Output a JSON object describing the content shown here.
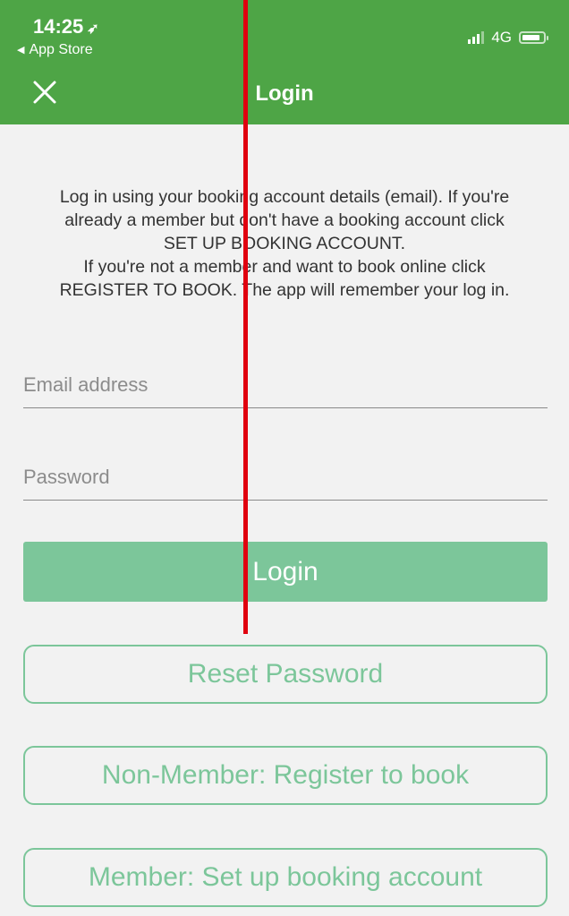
{
  "status_bar": {
    "time": "14:25",
    "back_app": "App Store",
    "network": "4G"
  },
  "header": {
    "title": "Login"
  },
  "intro_text": "Log in using your booking account details (email). If you're\nalready a member but don't have a booking account click\nSET UP BOOKING ACCOUNT.\nIf you're not a member and want to book online click\nREGISTER TO BOOK.  The app will remember your log in.",
  "form": {
    "email": {
      "placeholder": "Email address",
      "value": ""
    },
    "password": {
      "placeholder": "Password",
      "value": ""
    },
    "login_label": "Login"
  },
  "buttons": {
    "reset": "Reset Password",
    "register": "Non-Member: Register to book",
    "member": "Member: Set up booking account"
  },
  "colors": {
    "header": "#4ea546",
    "accent": "#7cc69a",
    "annotation": "#e0000f"
  },
  "icons": {
    "close": "close-icon",
    "location": "location-arrow-icon",
    "signal": "signal-icon",
    "battery": "battery-icon"
  }
}
